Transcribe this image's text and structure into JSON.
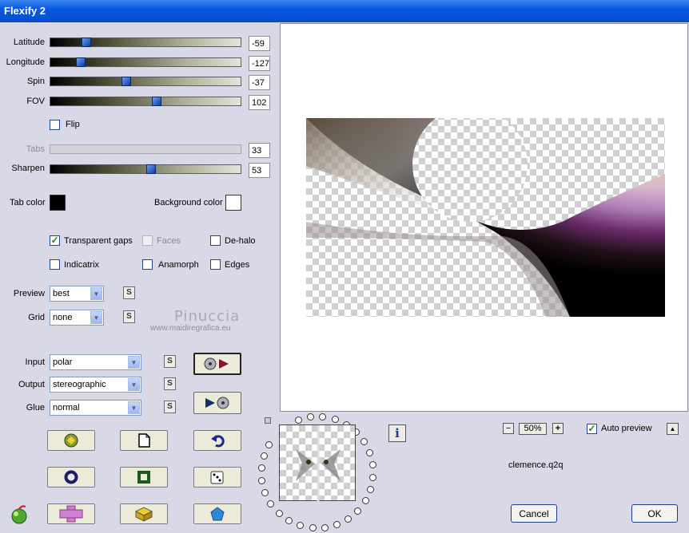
{
  "window": {
    "title": "Flexify 2"
  },
  "sliders": [
    {
      "label": "Latitude",
      "value": "-59",
      "fraction": 0.19,
      "disabled": false
    },
    {
      "label": "Longitude",
      "value": "-127",
      "fraction": 0.16,
      "disabled": false
    },
    {
      "label": "Spin",
      "value": "-37",
      "fraction": 0.4,
      "disabled": false
    },
    {
      "label": "FOV",
      "value": "102",
      "fraction": 0.56,
      "disabled": false
    }
  ],
  "flip": {
    "label": "Flip",
    "checked": false
  },
  "tabs": {
    "label": "Tabs",
    "value": "33"
  },
  "sharpen": {
    "label": "Sharpen",
    "value": "53",
    "fraction": 0.53
  },
  "tab_color": {
    "label": "Tab color",
    "color": "#000000"
  },
  "background_color": {
    "label": "Background color",
    "color": "#ffffff"
  },
  "options": {
    "transparent_gaps": {
      "label": "Transparent gaps",
      "checked": true
    },
    "faces": {
      "label": "Faces",
      "checked": false,
      "disabled": true
    },
    "de_halo": {
      "label": "De-halo",
      "checked": false
    },
    "indicatrix": {
      "label": "Indicatrix",
      "checked": false
    },
    "anamorph": {
      "label": "Anamorph",
      "checked": false
    },
    "edges": {
      "label": "Edges",
      "checked": false
    }
  },
  "preview_select": {
    "label": "Preview",
    "value": "best"
  },
  "grid_select": {
    "label": "Grid",
    "value": "none"
  },
  "input_select": {
    "label": "Input",
    "value": "polar"
  },
  "output_select": {
    "label": "Output",
    "value": "stereographic"
  },
  "glue_select": {
    "label": "Glue",
    "value": "normal"
  },
  "small_s": "S",
  "watermark": {
    "name": "Pinuccia",
    "url": "www.maidiregrafica.eu"
  },
  "zoom": {
    "value": "50%",
    "minus": "−",
    "plus": "+"
  },
  "auto_preview": {
    "label": "Auto preview",
    "checked": true,
    "collapse": "▲"
  },
  "filename": "clemence.q2q",
  "buttons": {
    "cancel": "Cancel",
    "ok": "OK"
  },
  "info_label": "i",
  "icons": {
    "load": "load-preset-icon",
    "new": "new-document-icon",
    "undo": "undo-icon",
    "ring": "ring-icon",
    "square": "square-frame-icon",
    "dice": "dice-icon",
    "cross": "cross-shape-icon",
    "cube": "cube-icon",
    "pentagon": "pentagon-icon",
    "apple": "apple-logo-icon"
  }
}
